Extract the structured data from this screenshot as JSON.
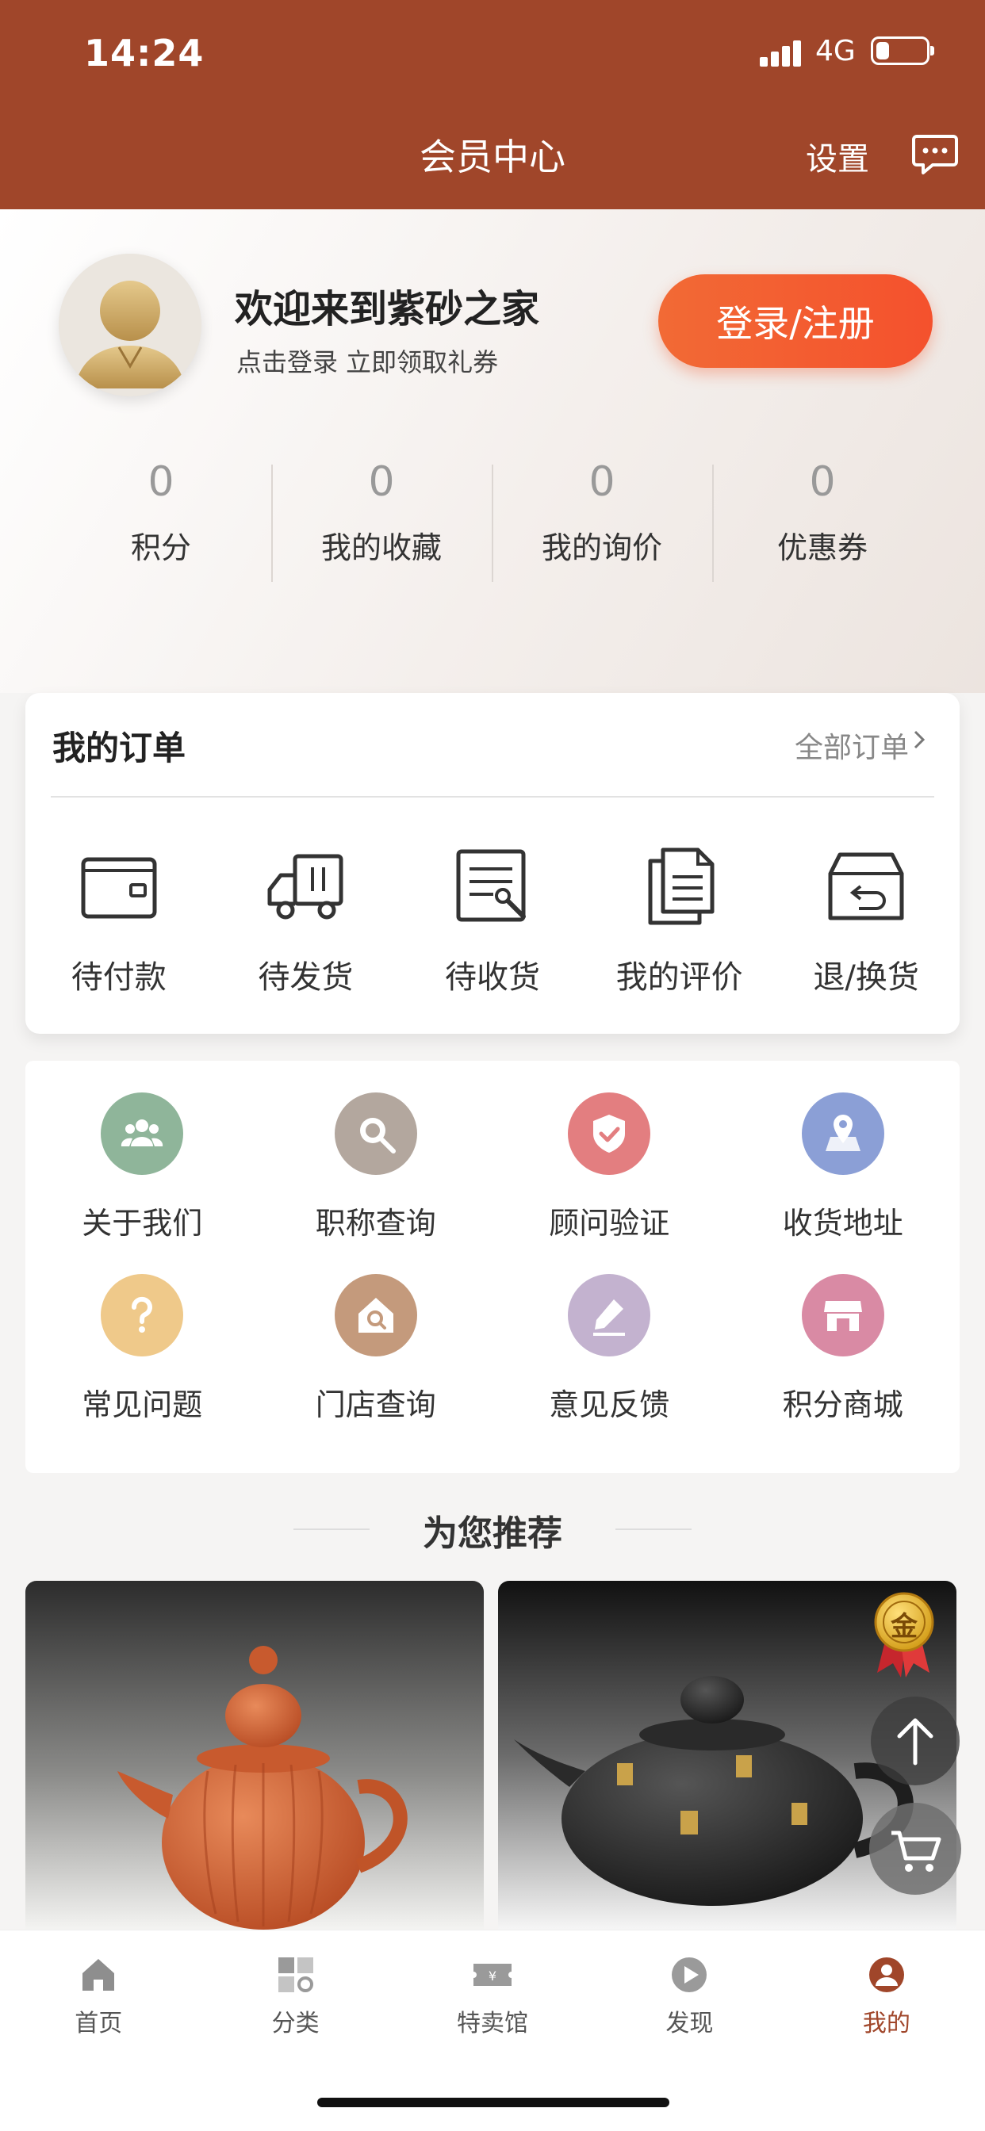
{
  "status_bar": {
    "time": "14:24",
    "network": "4G",
    "battery_level": 0.25
  },
  "nav": {
    "title": "会员中心",
    "settings_label": "设置",
    "message_icon": "chat-bubble-icon"
  },
  "profile": {
    "avatar_icon": "user-avatar-icon",
    "welcome": "欢迎来到紫砂之家",
    "subtitle": "点击登录 立即领取礼券",
    "login_label": "登录/注册"
  },
  "stats": [
    {
      "value": "0",
      "label": "积分"
    },
    {
      "value": "0",
      "label": "我的收藏"
    },
    {
      "value": "0",
      "label": "我的询价"
    },
    {
      "value": "0",
      "label": "优惠券"
    }
  ],
  "orders": {
    "title": "我的订单",
    "all_label": "全部订单",
    "items": [
      {
        "label": "待付款",
        "icon": "wallet-icon"
      },
      {
        "label": "待发货",
        "icon": "truck-icon"
      },
      {
        "label": "待收货",
        "icon": "receipt-icon"
      },
      {
        "label": "我的评价",
        "icon": "review-doc-icon"
      },
      {
        "label": "退/换货",
        "icon": "return-box-icon"
      }
    ]
  },
  "services": [
    {
      "label": "关于我们",
      "icon": "group-icon",
      "color": "#8fb59a"
    },
    {
      "label": "职称查询",
      "icon": "search-icon",
      "color": "#b3a79e"
    },
    {
      "label": "顾问验证",
      "icon": "shield-check-icon",
      "color": "#e37e80"
    },
    {
      "label": "收货地址",
      "icon": "location-icon",
      "color": "#8b9fd6"
    },
    {
      "label": "常见问题",
      "icon": "question-icon",
      "color": "#efc98a"
    },
    {
      "label": "门店查询",
      "icon": "store-search-icon",
      "color": "#c49a7c"
    },
    {
      "label": "意见反馈",
      "icon": "edit-icon",
      "color": "#c3b2cf"
    },
    {
      "label": "积分商城",
      "icon": "shop-icon",
      "color": "#d98aa4"
    }
  ],
  "recommend": {
    "title": "为您推荐",
    "products": [
      {
        "image": "orange-teapot-image"
      },
      {
        "image": "black-teapot-image",
        "badge": "金"
      }
    ]
  },
  "floating": {
    "scroll_top_icon": "arrow-up-icon",
    "cart_icon": "cart-icon"
  },
  "tabbar": [
    {
      "label": "首页",
      "icon": "home-icon",
      "active": false
    },
    {
      "label": "分类",
      "icon": "category-icon",
      "active": false
    },
    {
      "label": "特卖馆",
      "icon": "sale-ticket-icon",
      "active": false
    },
    {
      "label": "发现",
      "icon": "play-icon",
      "active": false
    },
    {
      "label": "我的",
      "icon": "profile-icon",
      "active": true
    }
  ],
  "colors": {
    "brand": "#a0462a",
    "accent": "#f4512d"
  }
}
